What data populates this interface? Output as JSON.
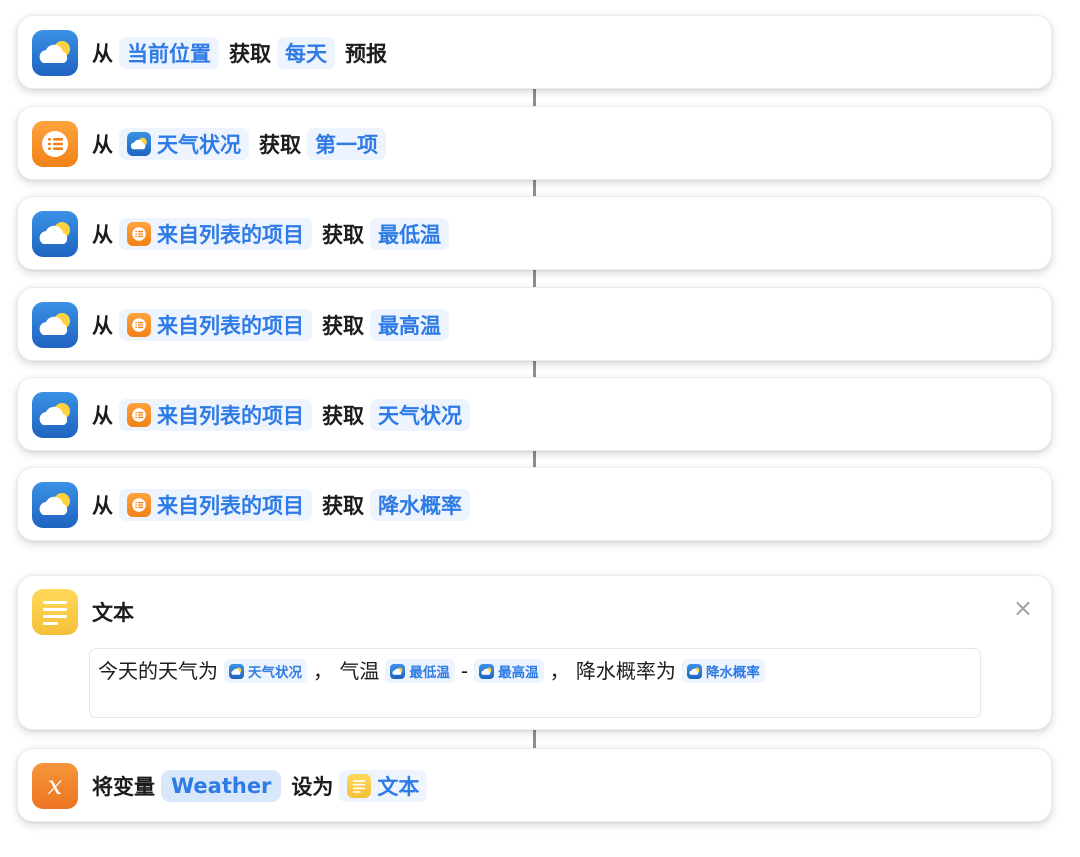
{
  "actions": [
    {
      "icon": "weather",
      "from": "从",
      "source": "当前位置",
      "source_icon": "",
      "get": "获取",
      "target": "每天",
      "suffix": "预报"
    },
    {
      "icon": "list",
      "from": "从",
      "source": "天气状况",
      "source_icon": "weather",
      "get": "获取",
      "target": "第一项",
      "suffix": ""
    },
    {
      "icon": "weather",
      "from": "从",
      "source": "来自列表的项目",
      "source_icon": "list",
      "get": "获取",
      "target": "最低温",
      "suffix": ""
    },
    {
      "icon": "weather",
      "from": "从",
      "source": "来自列表的项目",
      "source_icon": "list",
      "get": "获取",
      "target": "最高温",
      "suffix": ""
    },
    {
      "icon": "weather",
      "from": "从",
      "source": "来自列表的项目",
      "source_icon": "list",
      "get": "获取",
      "target": "天气状况",
      "suffix": ""
    },
    {
      "icon": "weather",
      "from": "从",
      "source": "来自列表的项目",
      "source_icon": "list",
      "get": "获取",
      "target": "降水概率",
      "suffix": ""
    }
  ],
  "text_action": {
    "title": "文本",
    "close": "×",
    "content": {
      "p1": "今天的天气为",
      "v1": "天气状况",
      "p2": "，  气温",
      "v2": "最低温",
      "p3": "-",
      "v3": "最高温",
      "p4": "，  降水概率为",
      "v4": "降水概率"
    }
  },
  "set_variable": {
    "label": "将变量",
    "variable": "Weather",
    "set_to": "设为",
    "value": "文本"
  },
  "colors": {
    "token_text": "#2f7be5",
    "token_bg": "#eef4fd",
    "weather_icon": "#2b7bd6",
    "list_icon": "#f59330",
    "text_icon": "#f8cc47",
    "variable_icon": "#ef7f2a"
  }
}
